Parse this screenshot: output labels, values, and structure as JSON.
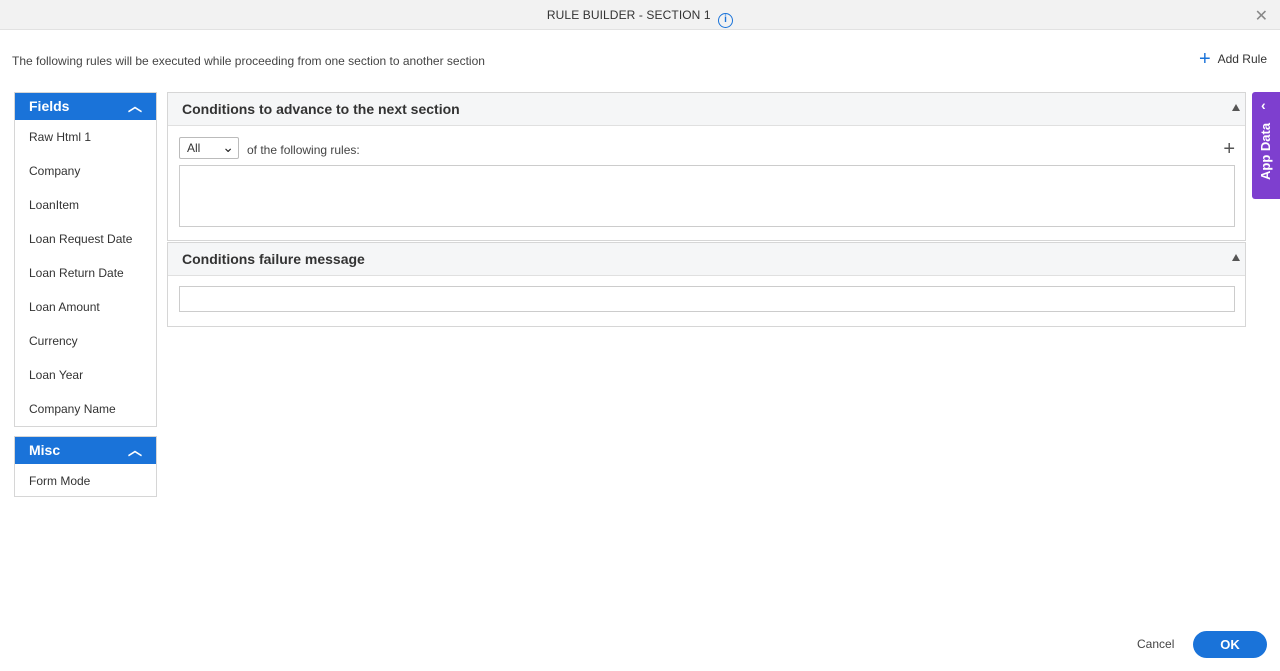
{
  "dialog": {
    "title": "RULE BUILDER - SECTION 1",
    "info_icon": "info-icon",
    "close_icon": "close-icon"
  },
  "description": "The following rules will be executed while proceeding from one section to another section",
  "add_rule": {
    "label": "Add Rule",
    "icon": "plus-icon"
  },
  "fields_panel": {
    "title": "Fields",
    "items": [
      "Raw Html 1",
      "Company",
      "LoanItem",
      "Loan Request Date",
      "Loan Return Date",
      "Loan Amount",
      "Currency",
      "Loan Year",
      "Company Name"
    ]
  },
  "misc_panel": {
    "title": "Misc",
    "items": [
      "Form Mode"
    ]
  },
  "advance_section": {
    "title": "Conditions to advance to the next section",
    "match_select": "All",
    "following_text": "of the following rules:"
  },
  "failure_section": {
    "title": "Conditions failure message",
    "message_value": ""
  },
  "app_data": {
    "label": "App Data"
  },
  "footer": {
    "cancel_label": "Cancel",
    "ok_label": "OK"
  },
  "colors": {
    "accent": "#1a73d9",
    "app_data": "#7e3fcf"
  }
}
